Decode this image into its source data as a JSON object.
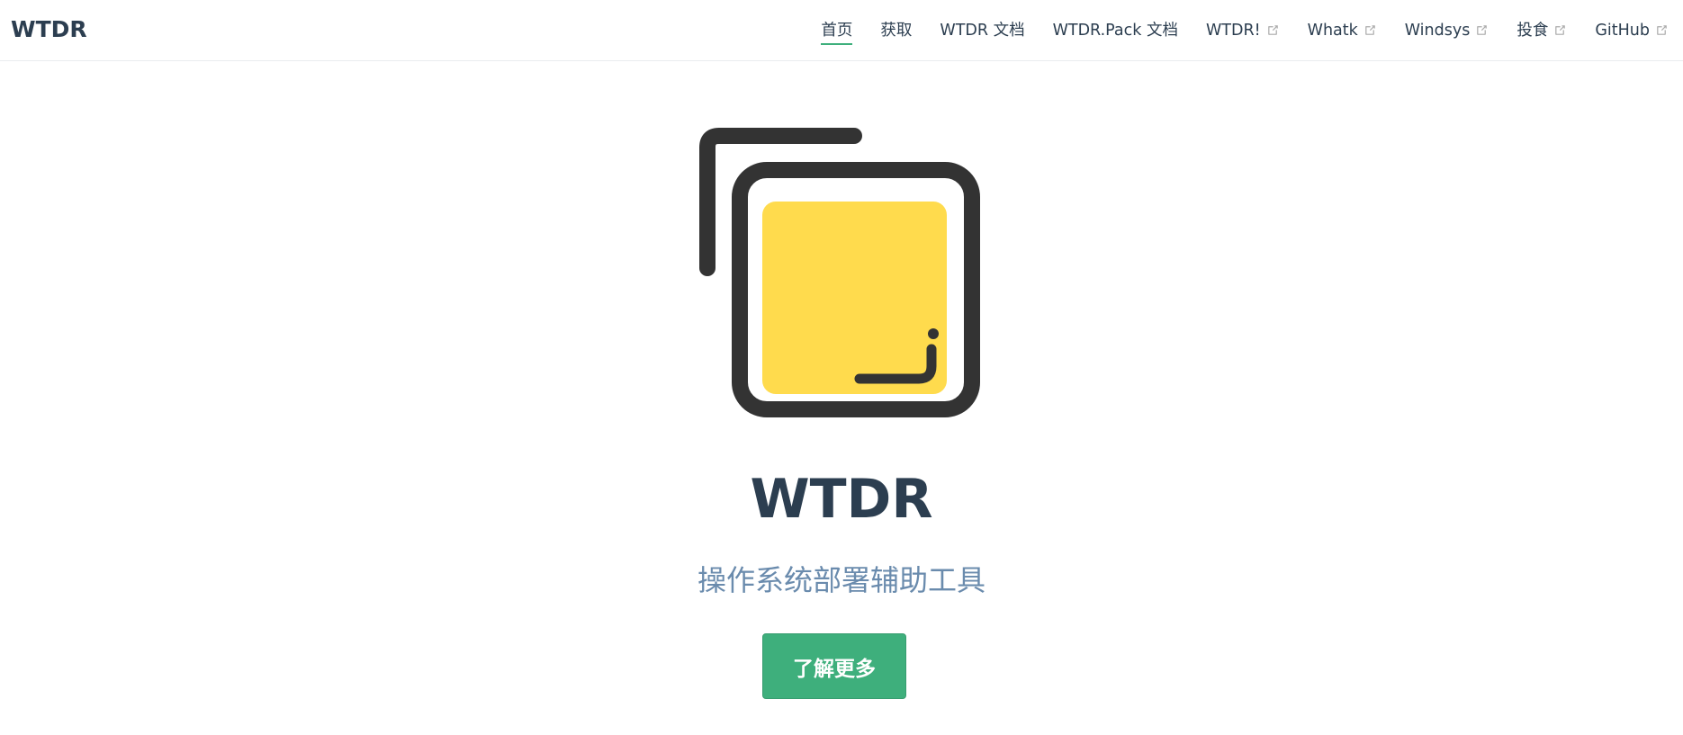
{
  "navbar": {
    "site_name": "WTDR",
    "links": [
      {
        "label": "首页",
        "external": false,
        "active": true
      },
      {
        "label": "获取",
        "external": false,
        "active": false
      },
      {
        "label": "WTDR 文档",
        "external": false,
        "active": false
      },
      {
        "label": "WTDR.Pack 文档",
        "external": false,
        "active": false
      },
      {
        "label": "WTDR!",
        "external": true,
        "active": false
      },
      {
        "label": "Whatk",
        "external": true,
        "active": false
      },
      {
        "label": "Windsys",
        "external": true,
        "active": false
      },
      {
        "label": "投食",
        "external": true,
        "active": false
      },
      {
        "label": "GitHub",
        "external": true,
        "active": false
      }
    ]
  },
  "hero": {
    "title": "WTDR",
    "description": "操作系统部署辅助工具",
    "action_label": "了解更多"
  },
  "colors": {
    "accent": "#3eaf7c",
    "text": "#2c3e50",
    "description": "#6a8bad",
    "logo_dark": "#333333",
    "logo_yellow": "#ffdb4d"
  }
}
